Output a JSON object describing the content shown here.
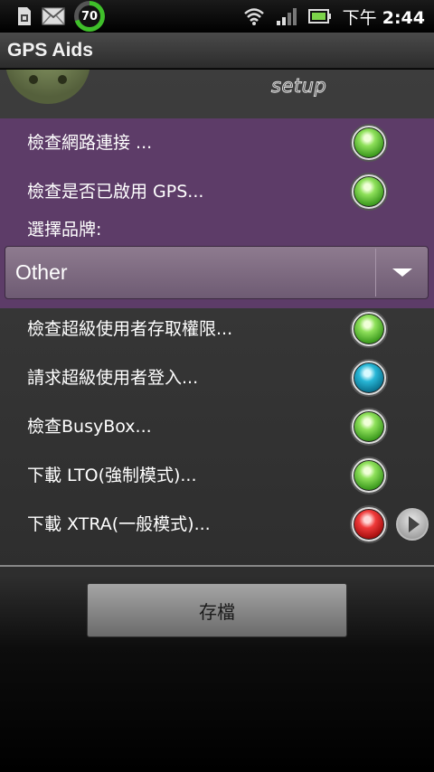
{
  "status_bar": {
    "battery_percent": "70",
    "time_period": "下午",
    "time": "2:44",
    "icons": [
      "sim-card-icon",
      "mail-icon",
      "battery-ring-icon",
      "wifi-icon",
      "signal-icon",
      "battery-icon"
    ]
  },
  "app": {
    "title": "GPS Aids"
  },
  "header": {
    "setup_label": "setup"
  },
  "checks_top": [
    {
      "label": "檢查網路連接 ...",
      "status": "green"
    },
    {
      "label": "檢查是否已啟用 GPS...",
      "status": "green"
    }
  ],
  "brand": {
    "label": "選擇品牌:",
    "selected": "Other"
  },
  "checks_bottom": [
    {
      "label": "檢查超級使用者存取權限...",
      "status": "green"
    },
    {
      "label": "請求超級使用者登入...",
      "status": "blue"
    },
    {
      "label": "檢查BusyBox...",
      "status": "green"
    },
    {
      "label": "下載 LTO(強制模式)...",
      "status": "green"
    },
    {
      "label": "下載 XTRA(一般模式)...",
      "status": "red",
      "has_action": true
    }
  ],
  "save_button": {
    "label": "存檔"
  },
  "colors": {
    "highlight": "#5d3c68",
    "led_green": "#3c9a1e",
    "led_blue": "#0a6f8c",
    "led_red": "#a30d0d"
  }
}
